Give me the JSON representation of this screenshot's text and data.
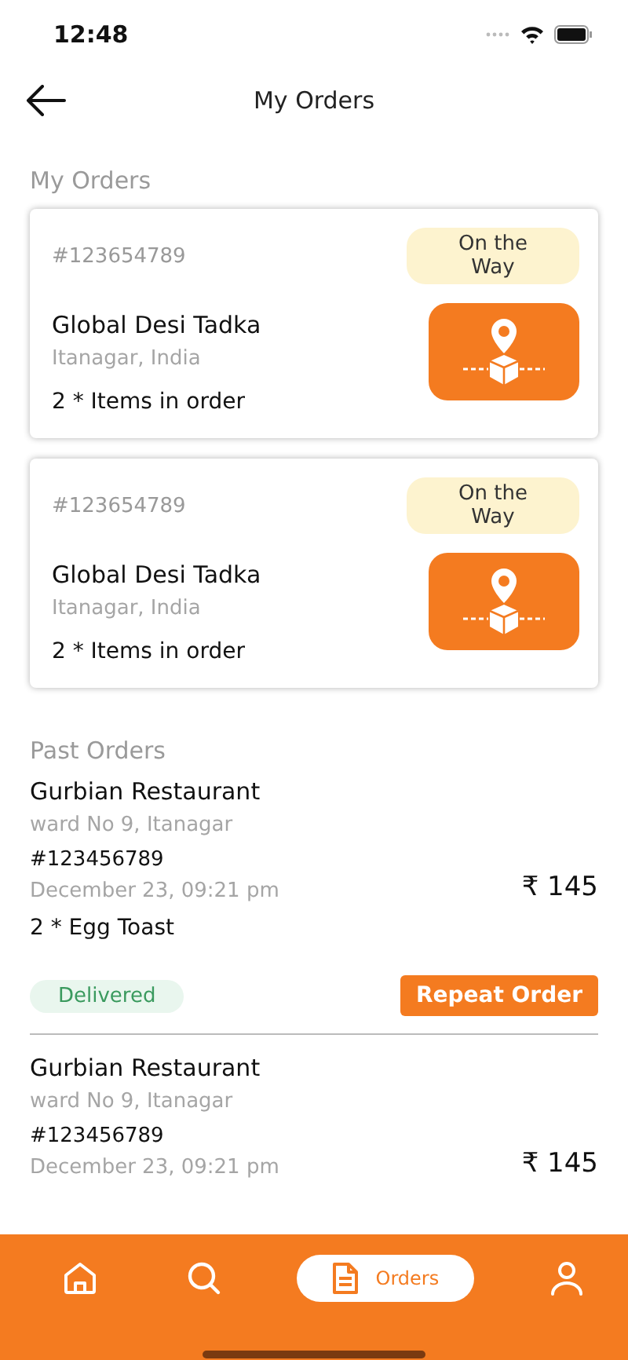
{
  "status_bar": {
    "time": "12:48"
  },
  "header": {
    "title": "My Orders"
  },
  "current_section": {
    "title": "My Orders",
    "orders": [
      {
        "order_id": "#123654789",
        "status": {
          "label": "On the Way",
          "kind": "on_way"
        },
        "restaurant": "Global Desi Tadka",
        "location": "Itanagar, India",
        "items": "2 * Items in order"
      },
      {
        "order_id": "#123654789",
        "status": {
          "label": "On the Way",
          "kind": "on_way"
        },
        "restaurant": "Global Desi Tadka",
        "location": "Itanagar, India",
        "items": "2 * Items in order"
      }
    ]
  },
  "past_section": {
    "title": "Past Orders",
    "orders": [
      {
        "restaurant": "Gurbian Restaurant",
        "address": "ward No 9, Itanagar",
        "order_id": "#123456789",
        "date": "December 23, 09:21 pm",
        "price": "₹ 145",
        "items": "2 * Egg Toast",
        "status": {
          "label": "Delivered",
          "kind": "delivered"
        },
        "action": "Repeat Order"
      },
      {
        "restaurant": "Gurbian Restaurant",
        "address": "ward No 9, Itanagar",
        "order_id": "#123456789",
        "date": "December 23, 09:21 pm",
        "price": "₹ 145"
      }
    ]
  },
  "bottom_nav": [
    {
      "kind": "home",
      "selected": false
    },
    {
      "kind": "search",
      "selected": false
    },
    {
      "kind": "orders",
      "label": "Orders",
      "selected": true
    },
    {
      "kind": "profile",
      "selected": false
    }
  ]
}
